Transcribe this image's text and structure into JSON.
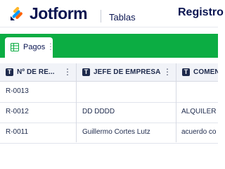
{
  "brand": {
    "name": "Jotform",
    "section": "Tablas"
  },
  "page_title": "Registro",
  "tabs": [
    {
      "label": "Pagos",
      "icon": "table-icon",
      "menu": "⋮"
    }
  ],
  "columns": [
    {
      "type_badge": "T",
      "label": "Nº DE RE...",
      "menu": "⋮"
    },
    {
      "type_badge": "T",
      "label": "JEFE DE EMPRESA",
      "menu": "⋮"
    },
    {
      "type_badge": "T",
      "label": "COMEN",
      "menu": ""
    }
  ],
  "rows": [
    {
      "cells": [
        "R-0013",
        "",
        ""
      ]
    },
    {
      "cells": [
        "R-0012",
        "DD DDDD",
        "ALQUILER"
      ]
    },
    {
      "cells": [
        "R-0011",
        "Guillermo Cortes Lutz",
        "acuerdo co"
      ]
    }
  ],
  "colors": {
    "accent_green": "#0cad43",
    "text_navy": "#0a1551"
  }
}
